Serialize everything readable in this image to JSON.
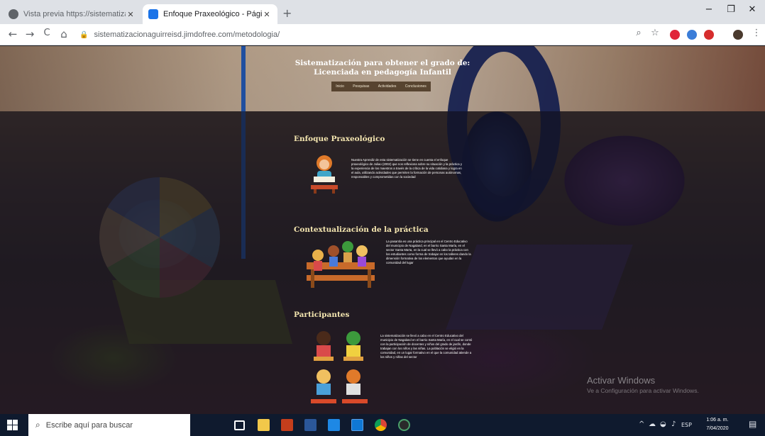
{
  "browser": {
    "tabs": [
      {
        "title": "Vista previa https://sistematizac",
        "active": false
      },
      {
        "title": "Enfoque Praxeológico - Página w",
        "active": true
      }
    ],
    "new_tab": "+",
    "window_controls": {
      "minimize": "−",
      "maximize": "❐",
      "close": "✕"
    },
    "nav": {
      "back": "←",
      "forward": "→",
      "reload": "C",
      "home": "⌂"
    },
    "address": "sistematizacionaguirreisd.jimdofree.com/metodologia/",
    "extensions": [
      "opera",
      "blue-ext",
      "red-ext",
      "avatar"
    ]
  },
  "site": {
    "header_title_line1": "Sistematización para obtener el grado de:",
    "header_title_line2": "Licenciada en pedagogía Infantil",
    "nav": [
      "Inicio",
      "Pesquisas",
      "Actividades",
      "Conclusiones"
    ],
    "sections": [
      {
        "title": "Enfoque Praxeológico",
        "text": "Nuestra Aprendiz de esta sistematización se tiene en cuenta el enfoque praxeológico de Juliao (2002) que nos reflexiona sobre su situación y la práctica y la experiencia de los maestros a través de la crítica de la vida cotidiana y logra en el aula, utilizando actividades que permiten la formación de personas autónomas, responsables y comprometidas con la sociedad"
      },
      {
        "title": "Contextualización de la práctica",
        "text": "La pasantía es una práctica principal en el Centro Educativo del municipio de Nagaland, en el barrio Santa María, en el sector Santa Marta, en la cual se llevó a cabo la práctica con los estudiantes como forma de trabajar en los talleres dando la dimensión formativa de los elementos que ayudan en la comunidad del lugar"
      },
      {
        "title": "Participantes",
        "text": "La sistematización se llevó a cabo en el Centro Educativo del municipio de Nagaland en el barrio Santa María, en el cual se contó con la participación de docentes y niños del grado de jardín, donde trabajan con los niños y las niñas. La población se eligió en la comunidad, en un lugar formativo en el que la comunidad atiende a los niños y niñas del sector"
      }
    ]
  },
  "windows": {
    "watermark_title": "Activar Windows",
    "watermark_sub": "Ve a Configuración para activar Windows.",
    "search_placeholder": "Escribe aquí para buscar",
    "clock_time": "1:06 a. m.",
    "clock_date": "7/04/2020",
    "tray_lang": "ESP"
  },
  "colors": {
    "tab_strip": "#dee1e6",
    "section_title": "#f4e6b0",
    "taskbar": "#0f1a2e"
  }
}
